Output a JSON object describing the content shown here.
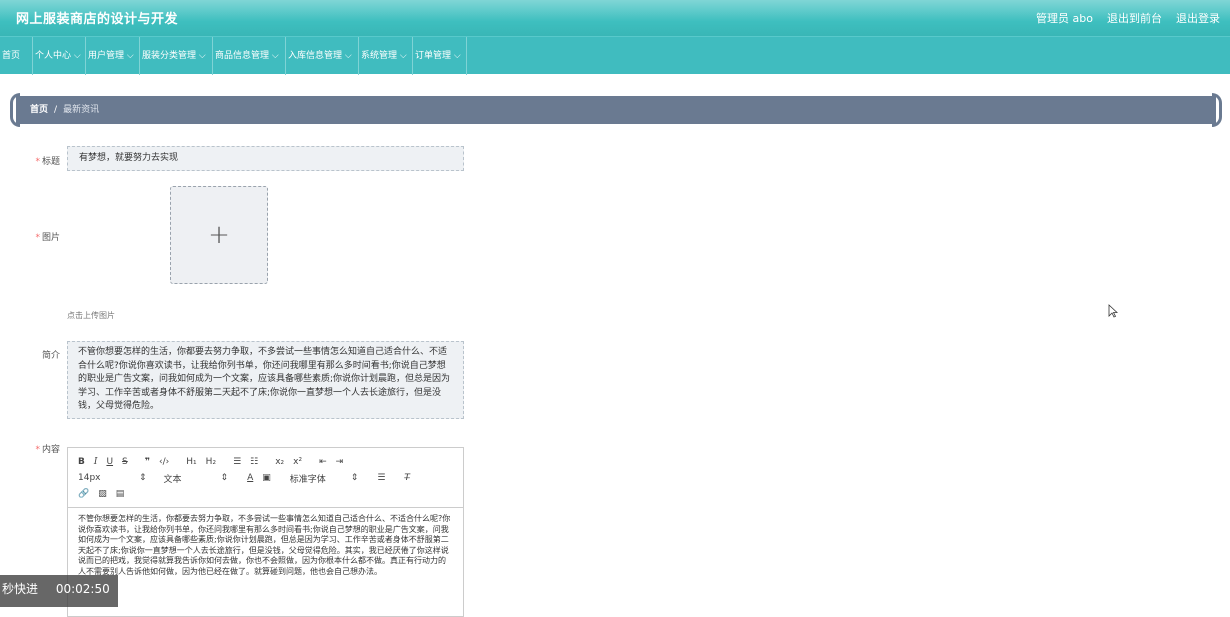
{
  "header": {
    "app_title": "网上服装商店的设计与开发",
    "user_label": "管理员 abo",
    "back_link": "退出到前台",
    "logout_link": "退出登录"
  },
  "nav": {
    "home": "首页",
    "items": [
      "个人中心",
      "用户管理",
      "服装分类管理",
      "商品信息管理",
      "入库信息管理",
      "系统管理",
      "订单管理"
    ]
  },
  "breadcrumb": {
    "home": "首页",
    "separator": "/",
    "current": "最新资讯"
  },
  "form": {
    "title_label": "标题",
    "title_value": "有梦想，就要努力去实现",
    "image_label": "图片",
    "upload_hint": "点击上传图片",
    "intro_label": "简介",
    "intro_value": "不管你想要怎样的生活，你都要去努力争取，不多尝试一些事情怎么知道自己适合什么、不适合什么呢?你说你喜欢读书，让我给你列书单，你还问我哪里有那么多时间看书;你说自己梦想的职业是广告文案，问我如何成为一个文案，应该具备哪些素质;你说你计划晨跑，但总是因为学习、工作辛苦或者身体不舒服第二天起不了床;你说你一直梦想一个人去长途旅行，但是没钱，父母觉得危险。",
    "content_label": "内容"
  },
  "editor": {
    "font_size": "14px",
    "text_type": "文本",
    "font_family": "标准字体",
    "content": "不管你想要怎样的生活，你都要去努力争取，不多尝试一些事情怎么知道自己适合什么、不适合什么呢?你说你喜欢读书，让我给你列书单，你还问我哪里有那么多时间看书;你说自己梦想的职业是广告文案，问我如何成为一个文案，应该具备哪些素质;你说你计划晨跑，但总是因为学习、工作辛苦或者身体不舒服第二天起不了床;你说你一直梦想一个人去长途旅行，但是没钱，父母觉得危险。其实，我已经厌倦了你这样说说而已的把戏，我觉得就算我告诉你如何去做，你也不会照做，因为你根本什么都不做。真正有行动力的人不需要别人告诉他如何做，因为他已经在做了。就算碰到问题，他也会自己想办法。"
  },
  "overlay": {
    "label": "秒快进",
    "time": "00:02:50"
  },
  "colors": {
    "header": "#3ebfbf",
    "breadcrumb": "#6a7a91",
    "required": "#f56c6c"
  }
}
